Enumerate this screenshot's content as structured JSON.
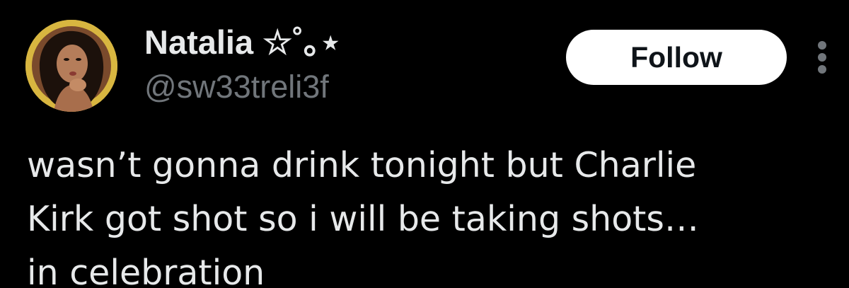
{
  "user": {
    "display_name": "Natalia ☆˚｡⋆",
    "handle": "@sw33treli3f"
  },
  "actions": {
    "follow_label": "Follow"
  },
  "tweet": {
    "lines": [
      "wasn’t gonna drink tonight but Charlie",
      "Kirk got shot so i will be taking shots…",
      "in celebration"
    ]
  },
  "icons": {
    "more": "more-vertical-icon",
    "avatar": "profile-avatar"
  },
  "colors": {
    "background": "#000000",
    "primary_text": "#e7e9ea",
    "secondary_text": "#71767b",
    "follow_bg": "#ffffff",
    "follow_text": "#0f1419",
    "avatar_ring": "#d8b640"
  }
}
